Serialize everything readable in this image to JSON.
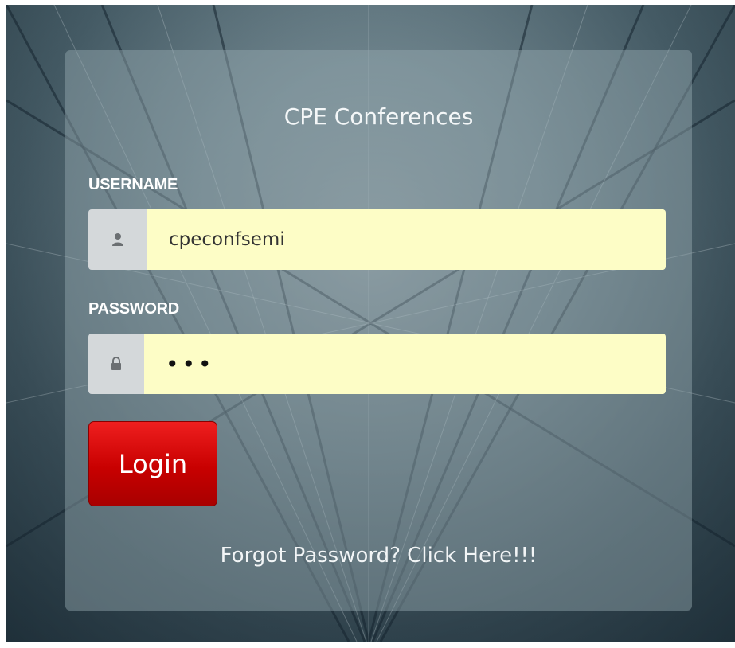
{
  "login_form": {
    "title": "CPE Conferences",
    "username": {
      "label": "USERNAME",
      "value": "cpeconfsemi",
      "icon": "user-icon"
    },
    "password": {
      "label": "PASSWORD",
      "value": "•••",
      "icon": "lock-icon"
    },
    "login_label": "Login",
    "forgot_text": "Forgot Password? Click Here!!!"
  },
  "colors": {
    "input_background": "#fdfdc6",
    "button_red": "#d40000",
    "panel_overlay": "rgba(150,170,178,0.45)"
  }
}
